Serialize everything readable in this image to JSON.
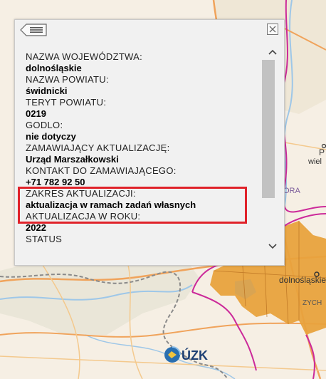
{
  "popup": {
    "fields": [
      {
        "label": "NAZWA WOJEWÓDZTWA:",
        "value": "dolnośląskie"
      },
      {
        "label": "NAZWA POWIATU:",
        "value": "świdnicki"
      },
      {
        "label": "TERYT POWIATU:",
        "value": "0219"
      },
      {
        "label": "GODLO:",
        "value": "nie dotyczy"
      },
      {
        "label": "ZAMAWIAJĄCY AKTUALIZACJĘ:",
        "value": "Urząd Marszałkowski"
      },
      {
        "label": "KONTAKT DO ZAMAWIAJĄCEGO:",
        "value": "+71 782 92 50"
      },
      {
        "label": "ZAKRES AKTUALIZACJI:",
        "value": "aktualizacja w ramach zadań własnych"
      },
      {
        "label": "AKTUALIZACJA W ROKU:",
        "value": "2022"
      },
      {
        "label": "STATUS",
        "value": ""
      }
    ],
    "highlight_color": "#e0222a"
  },
  "map": {
    "labels": {
      "region": "dolnośląskie",
      "ora_fragment": "ORA",
      "zych_fragment": "ZYCH",
      "wiel_fragment": "wiel",
      "p_fragment": "P"
    },
    "logo_text": "GUZK",
    "colors": {
      "region_fill": "#e8a23d",
      "border": "#cc2a9a",
      "background": "#f6efe4"
    }
  }
}
